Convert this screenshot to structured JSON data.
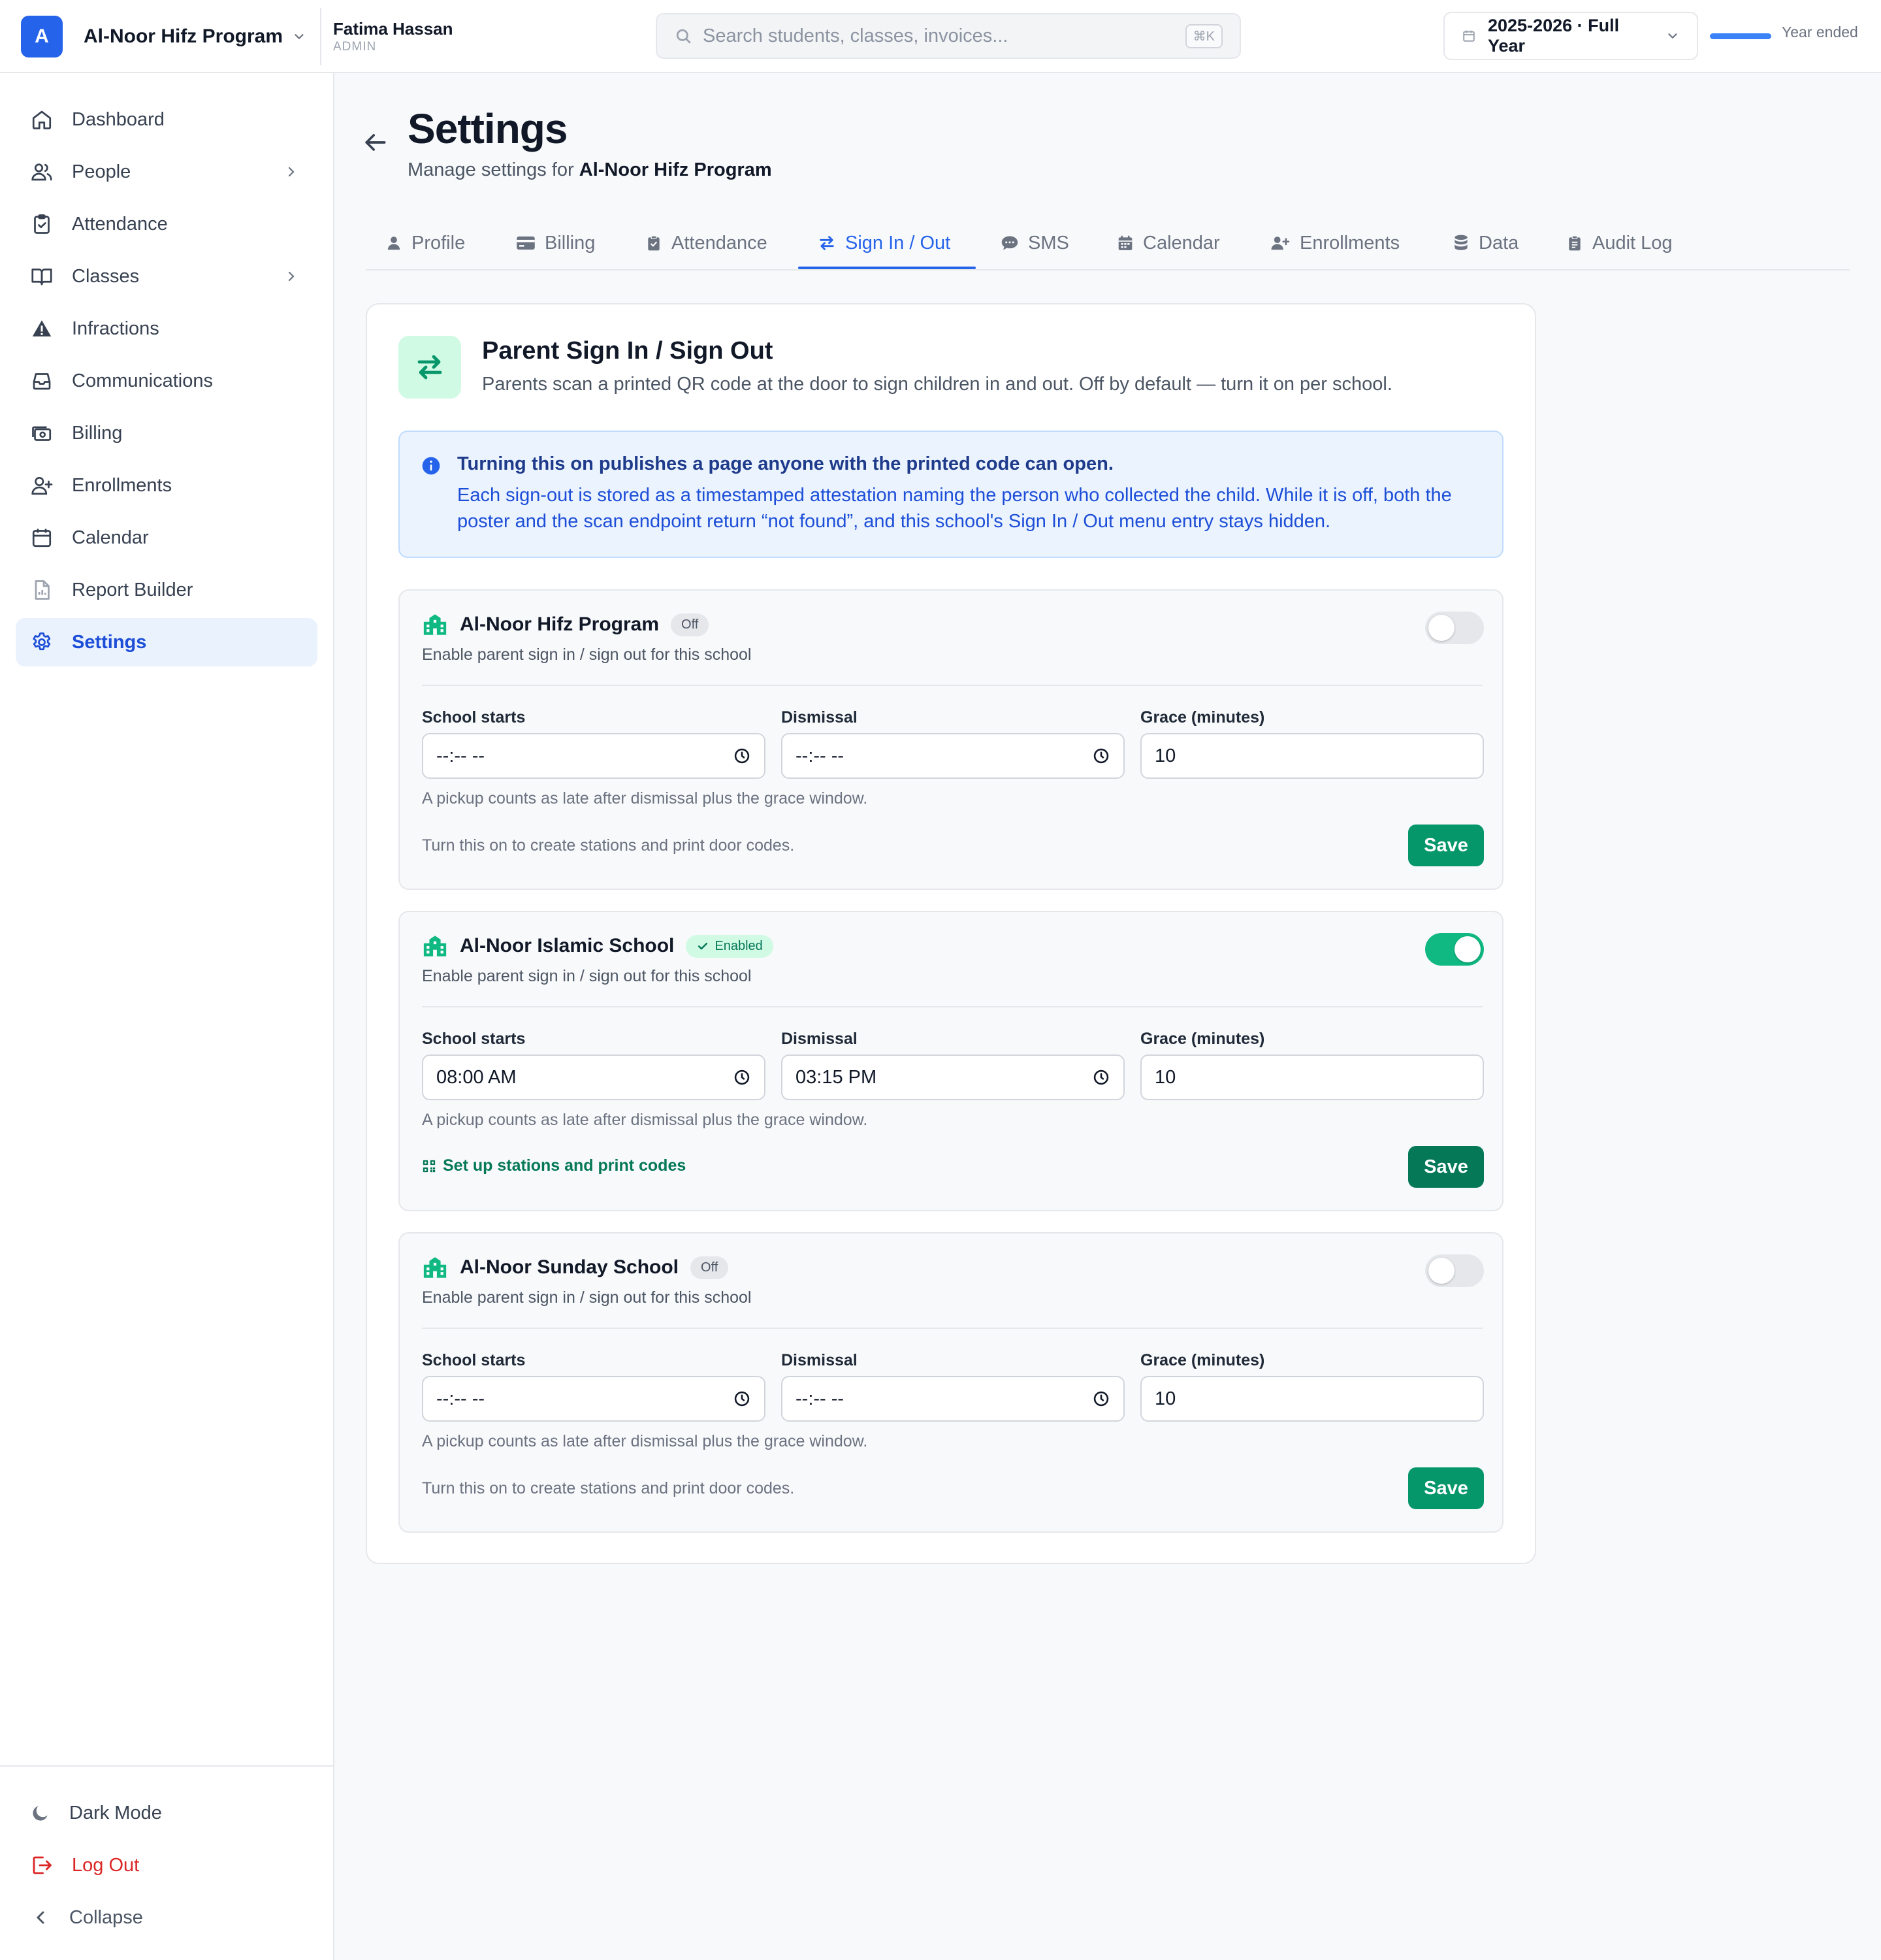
{
  "topbar": {
    "org_badge": "A",
    "org_name": "Al-Noor Hifz Program",
    "user_name": "Fatima Hassan",
    "user_role": "ADMIN",
    "search_placeholder": "Search students, classes, invoices...",
    "search_shortcut": "⌘K",
    "year_label": "2025-2026 · Full Year",
    "year_status": "Year ended",
    "year_progress": 1.0
  },
  "sidebar": {
    "items": [
      {
        "label": "Dashboard",
        "icon": "home-icon",
        "has_children": false
      },
      {
        "label": "People",
        "icon": "users-icon",
        "has_children": true
      },
      {
        "label": "Attendance",
        "icon": "clipboard-check-icon",
        "has_children": false
      },
      {
        "label": "Classes",
        "icon": "book-open-icon",
        "has_children": true
      },
      {
        "label": "Infractions",
        "icon": "warning-icon",
        "has_children": false
      },
      {
        "label": "Communications",
        "icon": "inbox-icon",
        "has_children": false
      },
      {
        "label": "Billing",
        "icon": "cash-icon",
        "has_children": false
      },
      {
        "label": "Enrollments",
        "icon": "user-plus-icon",
        "has_children": false
      },
      {
        "label": "Calendar",
        "icon": "calendar-icon",
        "has_children": false
      },
      {
        "label": "Report Builder",
        "icon": "report-icon",
        "has_children": false
      },
      {
        "label": "Settings",
        "icon": "gear-icon",
        "has_children": false,
        "active": true
      }
    ],
    "bottom": {
      "dark_mode": "Dark Mode",
      "logout": "Log Out",
      "collapse": "Collapse"
    }
  },
  "page": {
    "title": "Settings",
    "subtitle_prefix": "Manage settings for",
    "subtitle_org": "Al-Noor Hifz Program"
  },
  "tabs": [
    {
      "label": "Profile",
      "icon": "user-icon"
    },
    {
      "label": "Billing",
      "icon": "credit-card-icon"
    },
    {
      "label": "Attendance",
      "icon": "clipboard-check-icon"
    },
    {
      "label": "Sign In / Out",
      "icon": "arrows-swap-icon",
      "active": true
    },
    {
      "label": "SMS",
      "icon": "chat-icon"
    },
    {
      "label": "Calendar",
      "icon": "calendar-icon"
    },
    {
      "label": "Enrollments",
      "icon": "user-plus-icon"
    },
    {
      "label": "Data",
      "icon": "database-icon"
    },
    {
      "label": "Audit Log",
      "icon": "clipboard-list-icon"
    }
  ],
  "signinout": {
    "title": "Parent Sign In / Sign Out",
    "description": "Parents scan a printed QR code at the door to sign children in and out. Off by default — turn it on per school.",
    "info_title": "Turning this on publishes a page anyone with the printed code can open.",
    "info_body": "Each sign-out is stored as a timestamped attestation naming the person who collected the child. While it is off, both the poster and the scan endpoint return “not found”, and this school's Sign In / Out menu entry stays hidden.",
    "labels": {
      "enable_sub": "Enable parent sign in / sign out for this school",
      "school_starts": "School starts",
      "dismissal": "Dismissal",
      "grace": "Grace (minutes)",
      "hint": "A pickup counts as late after dismissal plus the grace window.",
      "off_footer": "Turn this on to create stations and print door codes.",
      "stations_link": "Set up stations and print codes",
      "save": "Save"
    },
    "schools": [
      {
        "name": "Al-Noor Hifz Program",
        "status": "Off",
        "enabled": false,
        "school_starts": "--:-- --",
        "dismissal": "--:-- --",
        "grace": "10"
      },
      {
        "name": "Al-Noor Islamic School",
        "status": "Enabled",
        "enabled": true,
        "school_starts": "08:00 AM",
        "dismissal": "03:15 PM",
        "grace": "10"
      },
      {
        "name": "Al-Noor Sunday School",
        "status": "Off",
        "enabled": false,
        "school_starts": "--:-- --",
        "dismissal": "--:-- --",
        "grace": "10"
      }
    ]
  },
  "colors": {
    "primary": "#2563eb",
    "success": "#059669",
    "danger": "#dc2626",
    "info_bg": "#eaf3fe"
  }
}
